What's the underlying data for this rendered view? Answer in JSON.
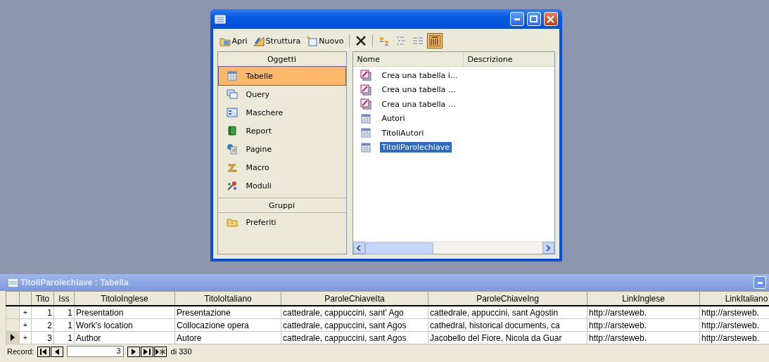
{
  "dialog": {
    "toolbar": [
      {
        "kind": "open",
        "label": "Apri"
      },
      {
        "kind": "design",
        "label": "Struttura"
      },
      {
        "kind": "new",
        "label": "Nuovo"
      },
      {
        "kind": "delete"
      },
      {
        "kind": "large-icons",
        "selected": false
      },
      {
        "kind": "small-icons",
        "selected": false
      },
      {
        "kind": "list",
        "selected": false
      },
      {
        "kind": "details",
        "selected": true
      }
    ],
    "objects_header": "Oggetti",
    "objects": [
      {
        "kind": "table",
        "label": "Tabelle",
        "selected": true
      },
      {
        "kind": "query",
        "label": "Query",
        "selected": false
      },
      {
        "kind": "form",
        "label": "Maschere",
        "selected": false
      },
      {
        "kind": "report",
        "label": "Report",
        "selected": false
      },
      {
        "kind": "page",
        "label": "Pagine",
        "selected": false
      },
      {
        "kind": "macro",
        "label": "Macro",
        "selected": false
      },
      {
        "kind": "module",
        "label": "Moduli",
        "selected": false
      }
    ],
    "groups_header": "Gruppi",
    "groups": [
      {
        "kind": "folder",
        "label": "Preferiti"
      }
    ],
    "list_columns": [
      "Nome",
      "Descrizione"
    ],
    "items": [
      {
        "kind": "wizard",
        "name": "Crea una tabella i…",
        "selected": false
      },
      {
        "kind": "wizard",
        "name": "Crea una tabella …",
        "selected": false
      },
      {
        "kind": "wizard",
        "name": "Crea una tabella …",
        "selected": false
      },
      {
        "kind": "table",
        "name": "Autori",
        "selected": false
      },
      {
        "kind": "table",
        "name": "TitoliAutori",
        "selected": false
      },
      {
        "kind": "table",
        "name": "TitoliParolechiave",
        "selected": true
      }
    ]
  },
  "datasheet": {
    "title": "TitoliParolechiave : Tabella",
    "columns": [
      "Tito",
      "Iss",
      "TitoloInglese",
      "TitoloItaliano",
      "ParoleChiaveIta",
      "ParoleChiaveIng",
      "LinkInglese",
      "LinkItaliano"
    ],
    "rows": [
      {
        "current": false,
        "expand": "+",
        "cells": [
          "1",
          "1",
          "Presentation",
          "Presentazione",
          "cattedrale, cappuccini, sant' Ago",
          "cattedrale, appuccini, sant Agostin",
          "http://arsteweb.",
          "http://arsteweb."
        ]
      },
      {
        "current": false,
        "expand": "+",
        "cells": [
          "2",
          "1",
          "Work's location",
          "Collocazione opera",
          "cattedrale, cappuccini, sant Agos",
          "cathedral, historical documents, ca",
          "http://arsteweb.",
          "http://arsteweb."
        ]
      },
      {
        "current": true,
        "expand": "+",
        "cells": [
          "3",
          "1",
          "Author",
          "Autore",
          "cattedrale, cappuccini, sant Agos",
          "Jacobello del Fiore, Nicola da Guar",
          "http://arsteweb.",
          "http://arsteweb."
        ]
      }
    ],
    "navigator": {
      "label": "Record:",
      "value": "3",
      "total": "di 330"
    }
  }
}
